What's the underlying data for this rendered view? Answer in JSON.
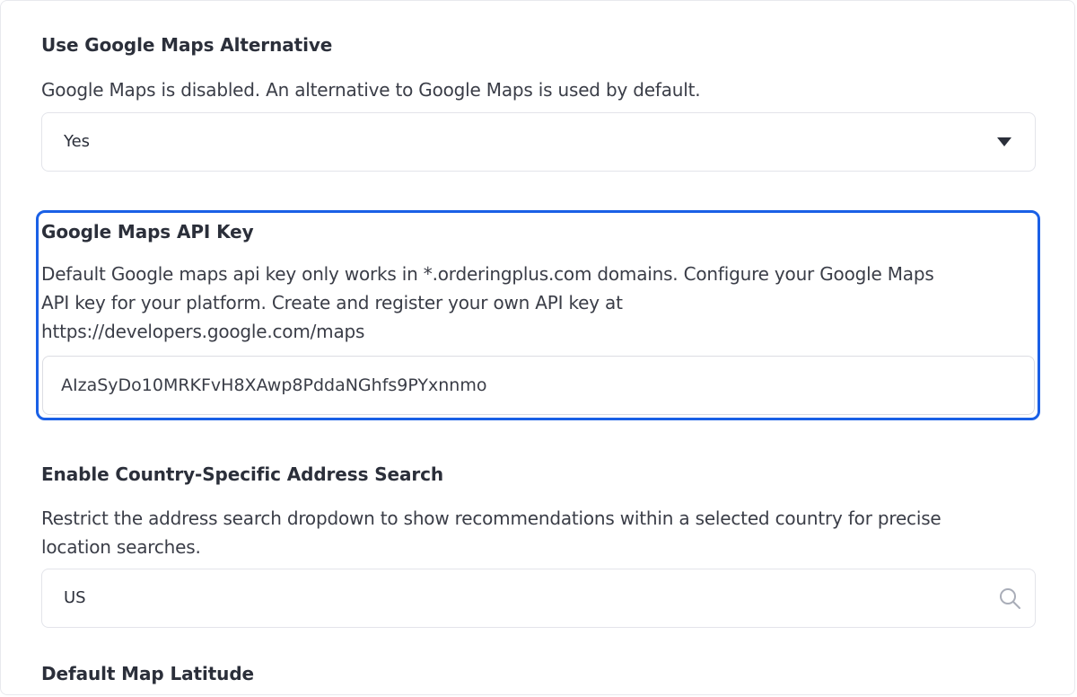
{
  "settings": {
    "alternative": {
      "title": "Use Google Maps Alternative",
      "description": "Google Maps is disabled. An alternative to Google Maps is used by default.",
      "value": "Yes"
    },
    "api_key": {
      "title": "Google Maps API Key",
      "description_line1": "Default Google maps api key only works in *.orderingplus.com domains. Configure your Google Maps",
      "description_line2": "API key for your platform. Create and register your own API key at",
      "description_line3": "https://developers.google.com/maps",
      "value": "AIzaSyDo10MRKFvH8XAwp8PddaNGhfs9PYxnnmo"
    },
    "country_search": {
      "title": "Enable Country-Specific Address Search",
      "description_line1": "Restrict the address search dropdown to show recommendations within a selected country for precise",
      "description_line2": "location searches.",
      "value": "US"
    },
    "latitude": {
      "title": "Default Map Latitude"
    }
  },
  "colors": {
    "focus": "#1a60e6",
    "text": "#2b2f3a",
    "border": "#e3e4ea"
  },
  "icons": {
    "dropdown": "chevron-down-icon",
    "search": "search-icon"
  }
}
